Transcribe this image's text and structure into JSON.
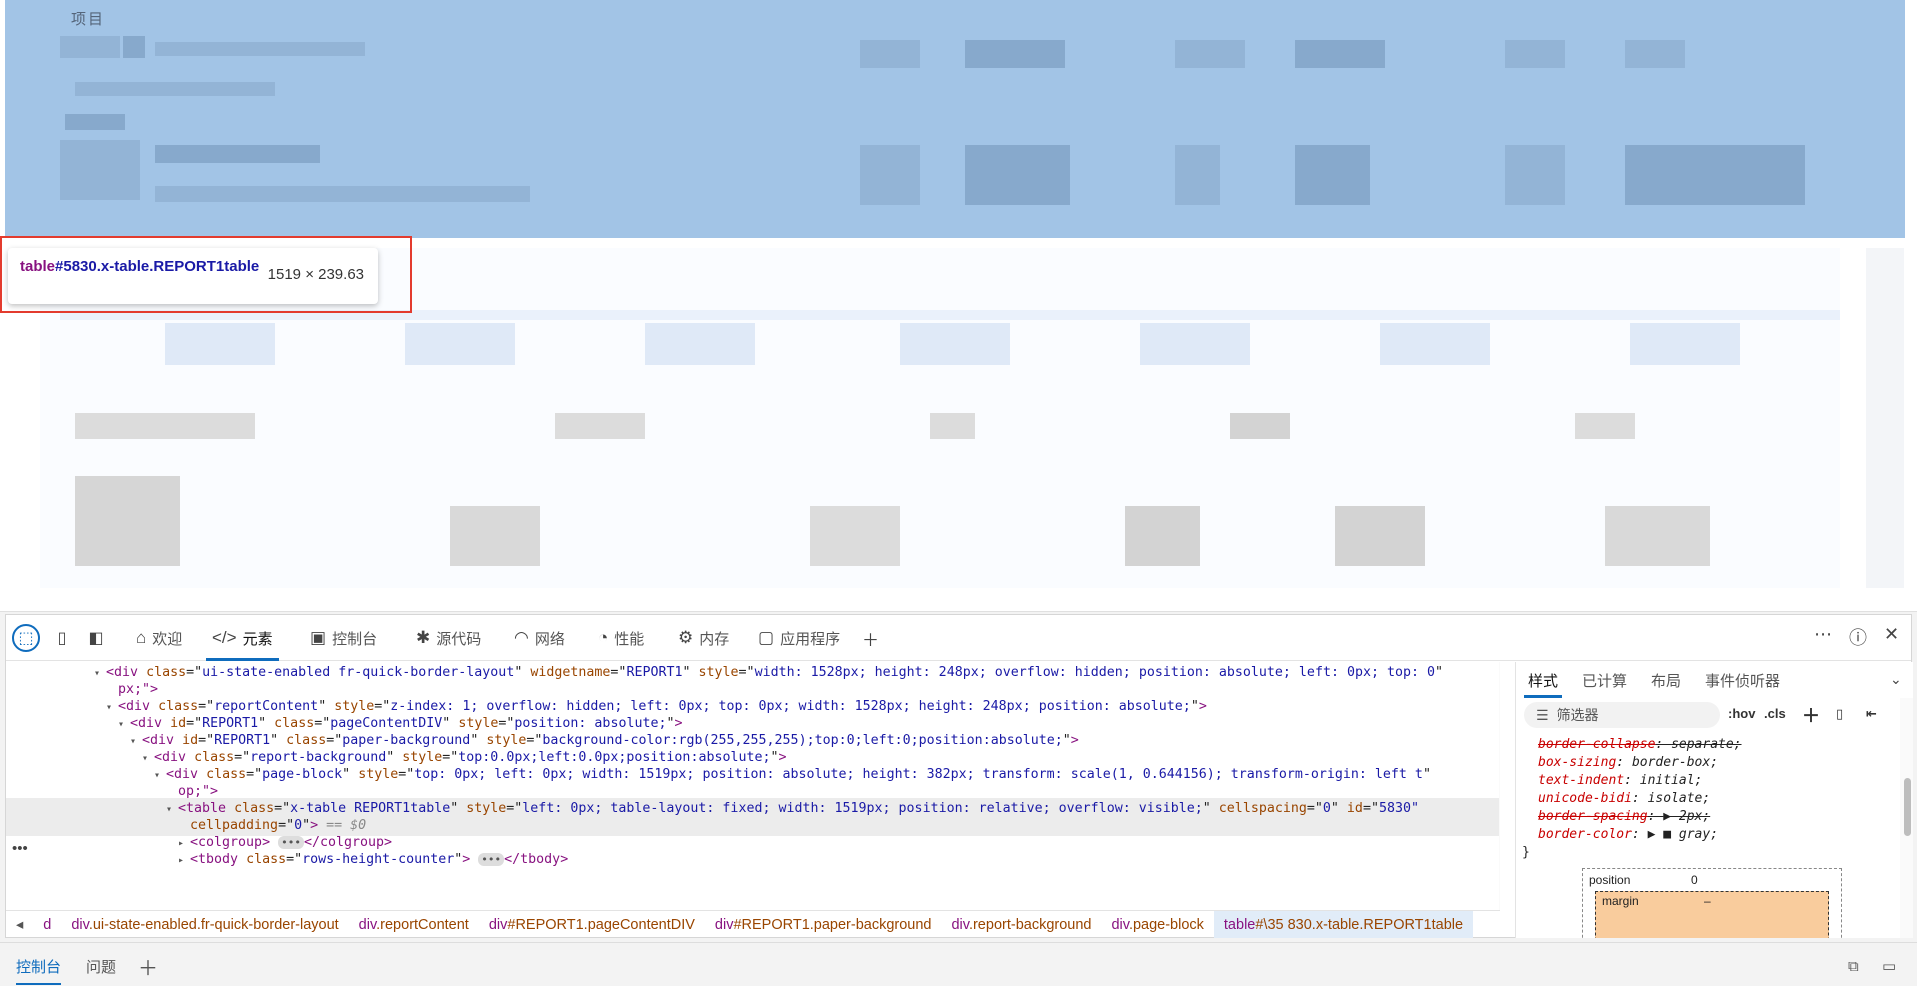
{
  "page": {
    "section_label": "项目"
  },
  "tooltip": {
    "tag": "table",
    "selector": "#5830.x-table.REPORT1table",
    "dimensions": "1519 × 239.63"
  },
  "devtools": {
    "tabs": [
      {
        "label": "欢迎",
        "icon": "home-icon"
      },
      {
        "label": "元素",
        "icon": "code-icon"
      },
      {
        "label": "控制台",
        "icon": "console-icon"
      },
      {
        "label": "源代码",
        "icon": "bug-icon"
      },
      {
        "label": "网络",
        "icon": "wifi-icon"
      },
      {
        "label": "性能",
        "icon": "gauge-icon"
      },
      {
        "label": "内存",
        "icon": "chip-icon"
      },
      {
        "label": "应用程序",
        "icon": "app-icon"
      }
    ],
    "dom_lines": [
      {
        "indent": 0,
        "twisty": "▾",
        "tag": "div",
        "attrs": [
          [
            "class",
            "ui-state-enabled fr-quick-border-layout"
          ],
          [
            "widgetname",
            "REPORT1"
          ],
          [
            "style",
            "width: 1528px; height: 248px; overflow: hidden; position: absolute; left: 0px; top: 0"
          ]
        ],
        "tail": ""
      },
      {
        "indent": 1,
        "twisty": "",
        "tag": "",
        "attrs": [],
        "tail": "px;\">"
      },
      {
        "indent": 1,
        "twisty": "▾",
        "tag": "div",
        "attrs": [
          [
            "class",
            "reportContent"
          ],
          [
            "style",
            "z-index: 1; overflow: hidden; left: 0px; top: 0px; width: 1528px; height: 248px; position: absolute;"
          ]
        ],
        "tail": ">"
      },
      {
        "indent": 2,
        "twisty": "▾",
        "tag": "div",
        "attrs": [
          [
            "id",
            "REPORT1"
          ],
          [
            "class",
            "pageContentDIV"
          ],
          [
            "style",
            "position: absolute;"
          ]
        ],
        "tail": ">"
      },
      {
        "indent": 3,
        "twisty": "▾",
        "tag": "div",
        "attrs": [
          [
            "id",
            "REPORT1"
          ],
          [
            "class",
            "paper-background"
          ],
          [
            "style",
            "background-color:rgb(255,255,255);top:0;left:0;position:absolute;"
          ]
        ],
        "tail": ">"
      },
      {
        "indent": 4,
        "twisty": "▾",
        "tag": "div",
        "attrs": [
          [
            "class",
            "report-background"
          ],
          [
            "style",
            "top:0.0px;left:0.0px;position:absolute;"
          ]
        ],
        "tail": ">"
      },
      {
        "indent": 5,
        "twisty": "▾",
        "tag": "div",
        "attrs": [
          [
            "class",
            "page-block"
          ],
          [
            "style",
            "top: 0px; left: 0px; width: 1519px; position: absolute; height: 382px; transform: scale(1, 0.644156); transform-origin: left t"
          ]
        ],
        "tail": ""
      },
      {
        "indent": 6,
        "twisty": "",
        "tag": "",
        "attrs": [],
        "tail": "op;\">"
      },
      {
        "indent": 6,
        "twisty": "▾",
        "tag": "table",
        "attrs": [
          [
            "class",
            "x-table REPORT1table"
          ],
          [
            "style",
            "left: 0px; table-layout: fixed; width: 1519px; position: relative; overflow: visible;"
          ],
          [
            "cellspacing",
            "0"
          ],
          [
            "id",
            "5830\""
          ]
        ],
        "tail": ""
      },
      {
        "indent": 7,
        "twisty": "",
        "tag": "",
        "attrs": [
          [
            "cellpadding",
            "0"
          ]
        ],
        "tail": ">",
        "eq": " == $0"
      },
      {
        "indent": 7,
        "twisty": "▸",
        "tag": "colgroup",
        "attrs": [],
        "tail": ">",
        "close": "colgroup"
      },
      {
        "indent": 7,
        "twisty": "▸",
        "tag": "tbody",
        "attrs": [
          [
            "class",
            "rows-height-counter"
          ]
        ],
        "tail": ">",
        "close": "tbody"
      }
    ],
    "breadcrumbs": [
      {
        "tag": "d",
        "cls": ""
      },
      {
        "tag": "div",
        "cls": ".ui-state-enabled.fr-quick-border-layout"
      },
      {
        "tag": "div",
        "cls": ".reportContent"
      },
      {
        "tag": "div",
        "cls": "#REPORT1.pageContentDIV"
      },
      {
        "tag": "div",
        "cls": "#REPORT1.paper-background"
      },
      {
        "tag": "div",
        "cls": ".report-background"
      },
      {
        "tag": "div",
        "cls": ".page-block"
      },
      {
        "tag": "table",
        "cls": "#\\35 830.x-table.REPORT1table"
      }
    ],
    "styles_tabs": [
      "样式",
      "已计算",
      "布局",
      "事件侦听器"
    ],
    "filter_placeholder": "筛选器",
    "hov_label": ":hov",
    "cls_label": ".cls",
    "style_props": [
      {
        "name": "border-collapse",
        "value": "separate;",
        "strike": true
      },
      {
        "name": "box-sizing",
        "value": "border-box;",
        "strike": false
      },
      {
        "name": "text-indent",
        "value": "initial;",
        "strike": false
      },
      {
        "name": "unicode-bidi",
        "value": "isolate;",
        "strike": false
      },
      {
        "name": "border-spacing",
        "value": "▶ 2px;",
        "strike": true
      },
      {
        "name": "border-color",
        "value": "▶ ■ gray;",
        "strike": false
      }
    ],
    "box_model": {
      "position_label": "position",
      "position_value": "0",
      "margin_label": "margin",
      "margin_value": "–"
    }
  },
  "drawer": {
    "tabs": [
      "控制台",
      "问题"
    ]
  },
  "colors": {
    "highlight": "#a2c4e6",
    "accent": "#0f6cbd",
    "red_box": "#e33b2e"
  }
}
